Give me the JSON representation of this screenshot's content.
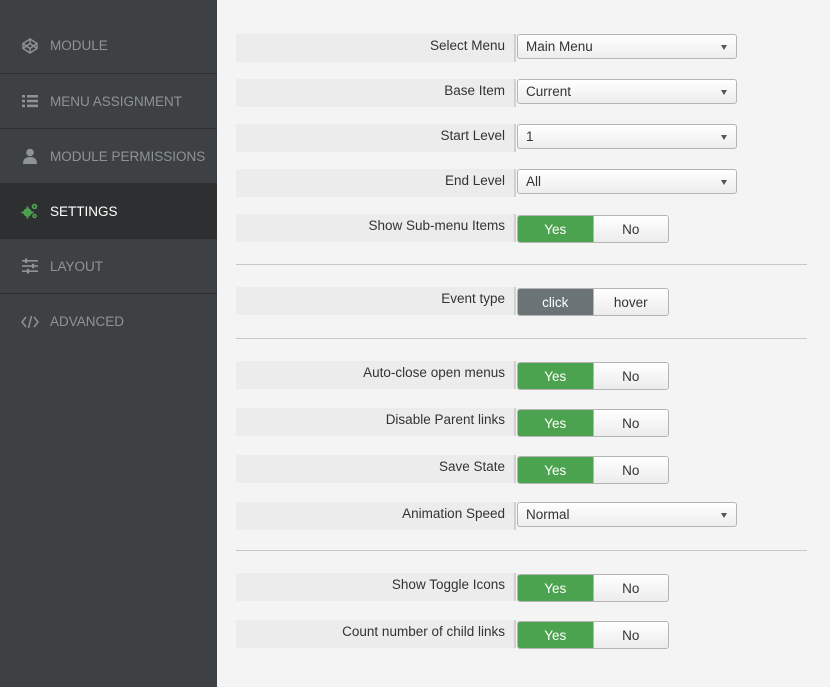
{
  "sidebar": {
    "items": [
      {
        "label": "MODULE",
        "icon": "codepen-icon"
      },
      {
        "label": "MENU ASSIGNMENT",
        "icon": "list-icon"
      },
      {
        "label": "MODULE PERMISSIONS",
        "icon": "user-icon"
      },
      {
        "label": "SETTINGS",
        "icon": "gears-icon",
        "active": true
      },
      {
        "label": "LAYOUT",
        "icon": "sliders-icon"
      },
      {
        "label": "ADVANCED",
        "icon": "code-icon"
      }
    ]
  },
  "settings": {
    "select_menu": {
      "label": "Select Menu",
      "value": "Main Menu"
    },
    "base_item": {
      "label": "Base Item",
      "value": "Current"
    },
    "start_level": {
      "label": "Start Level",
      "value": "1"
    },
    "end_level": {
      "label": "End Level",
      "value": "All"
    },
    "show_submenu": {
      "label": "Show Sub-menu Items",
      "yes": "Yes",
      "no": "No",
      "selected": "Yes"
    },
    "event_type": {
      "label": "Event type",
      "opt1": "click",
      "opt2": "hover",
      "selected": "click"
    },
    "auto_close": {
      "label": "Auto-close open menus",
      "yes": "Yes",
      "no": "No",
      "selected": "Yes"
    },
    "disable_parent": {
      "label": "Disable Parent links",
      "yes": "Yes",
      "no": "No",
      "selected": "Yes"
    },
    "save_state": {
      "label": "Save State",
      "yes": "Yes",
      "no": "No",
      "selected": "Yes"
    },
    "animation_speed": {
      "label": "Animation Speed",
      "value": "Normal"
    },
    "show_toggle_icons": {
      "label": "Show Toggle Icons",
      "yes": "Yes",
      "no": "No",
      "selected": "Yes"
    },
    "count_child_links": {
      "label": "Count number of child links",
      "yes": "Yes",
      "no": "No",
      "selected": "Yes"
    }
  },
  "colors": {
    "sidebar_bg": "#3e4144",
    "sidebar_active_bg": "#2d2f31",
    "yes_green": "#4ca34f",
    "click_dark": "#6a7477",
    "settings_icon_green": "#4ca34f"
  }
}
